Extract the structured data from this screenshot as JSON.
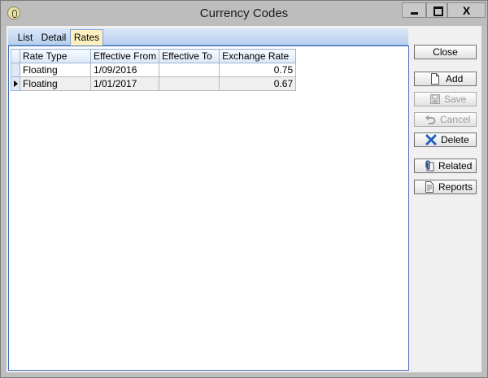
{
  "window": {
    "title": "Currency Codes"
  },
  "titlebar": {
    "close_glyph": "X"
  },
  "tabs": [
    {
      "label": "List"
    },
    {
      "label": "Detail"
    },
    {
      "label": "Rates",
      "selected": true
    }
  ],
  "grid": {
    "columns": [
      "Rate Type",
      "Effective From",
      "Effective To",
      "Exchange Rate"
    ],
    "rows": [
      {
        "rate_type": "Floating",
        "effective_from": "1/09/2016",
        "effective_to": "",
        "exchange_rate": "0.75",
        "current": false
      },
      {
        "rate_type": "Floating",
        "effective_from": "1/01/2017",
        "effective_to": "",
        "exchange_rate": "0.67",
        "current": true
      }
    ]
  },
  "buttons": {
    "close": {
      "label": "Close"
    },
    "add": {
      "label": "Add",
      "icon": "new-document-icon"
    },
    "save": {
      "label": "Save",
      "icon": "floppy-disk-icon",
      "enabled": false
    },
    "cancel": {
      "label": "Cancel",
      "icon": "undo-arrow-icon",
      "enabled": false
    },
    "delete": {
      "label": "Delete",
      "icon": "blue-x-icon"
    },
    "related": {
      "label": "Related",
      "icon": "paperclip-icon"
    },
    "reports": {
      "label": "Reports",
      "icon": "report-document-icon"
    }
  },
  "colors": {
    "tab_selected": "#fff1bf",
    "panel_border": "#4470b8",
    "delete_icon": "#1f5fbf"
  }
}
